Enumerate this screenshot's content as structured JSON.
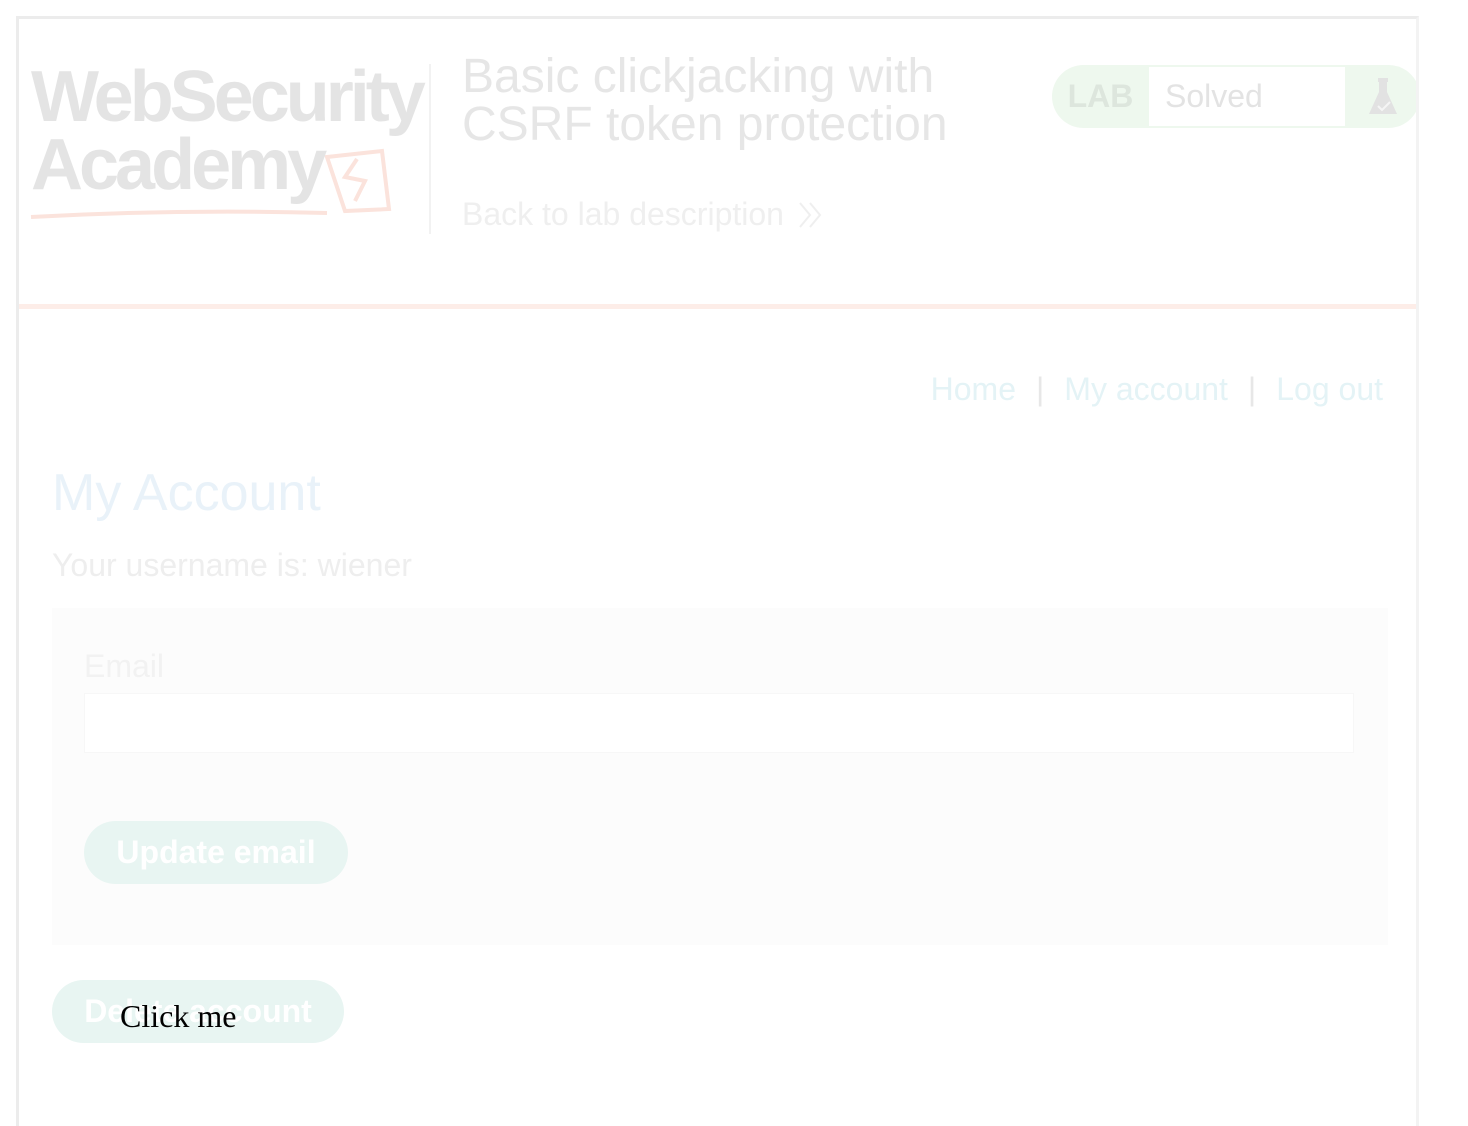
{
  "logo": {
    "line1": "WebSecurity",
    "line2": "Academy"
  },
  "lab": {
    "title": "Basic clickjacking with CSRF token protection",
    "back_link": "Back to lab description",
    "badge_label": "LAB",
    "status": "Solved"
  },
  "nav": {
    "home": "Home",
    "separator": "|",
    "my_account": "My account",
    "log_out": "Log out"
  },
  "account": {
    "heading": "My Account",
    "username_text": "Your username is: wiener",
    "email_label": "Email",
    "email_value": "",
    "update_button": "Update email",
    "delete_button": "Delete account"
  },
  "decoy": {
    "label": "Click me"
  },
  "colors": {
    "frame_border": "#ececec",
    "orange_rule": "#fdede8",
    "solved_badge": "#eef8ee",
    "button_bg": "#e8f5f2",
    "decoy_text": "#000000"
  }
}
